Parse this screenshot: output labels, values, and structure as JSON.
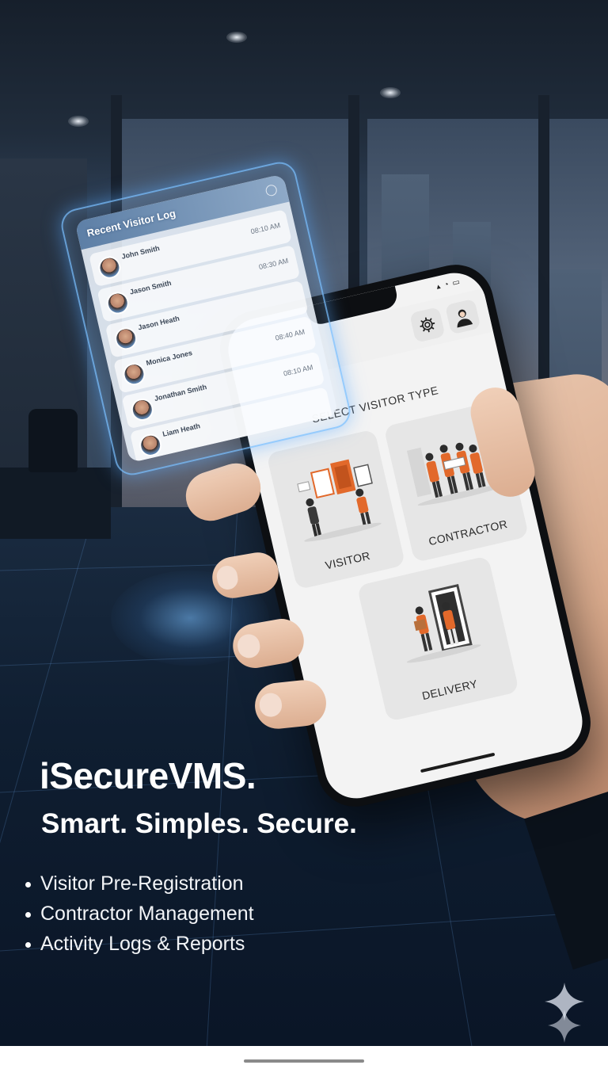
{
  "app": {
    "header": {
      "settings_icon": "gear-icon",
      "profile_icon": "user-avatar-icon"
    },
    "title": "SELECT VISITOR TYPE",
    "visitor_types": [
      {
        "label": "VISITOR",
        "illustration": "visitor-illustration"
      },
      {
        "label": "CONTRACTOR",
        "illustration": "contractor-illustration"
      },
      {
        "label": "DELIVERY",
        "illustration": "delivery-illustration"
      }
    ],
    "accent": "#e2692b"
  },
  "visitor_log": {
    "title": "Recent Visitor Log",
    "entries": [
      {
        "name": "John Smith",
        "time": "08:10 AM"
      },
      {
        "name": "Jason Smith",
        "time": "08:30 AM"
      },
      {
        "name": "Jason Heath",
        "time": ""
      },
      {
        "name": "Monica Jones",
        "time": "08:40 AM"
      },
      {
        "name": "Jonathan Smith",
        "time": "08:10 AM"
      },
      {
        "name": "Liam Heath",
        "time": ""
      }
    ]
  },
  "promo": {
    "brand": "iSecureVMS.",
    "tagline": "Smart. Simples. Secure.",
    "features": [
      "Visitor Pre-Registration",
      "Contractor Management",
      "Activity Logs & Reports"
    ]
  },
  "colors": {
    "glow": "#78beff",
    "background": "#0f1b2b"
  }
}
